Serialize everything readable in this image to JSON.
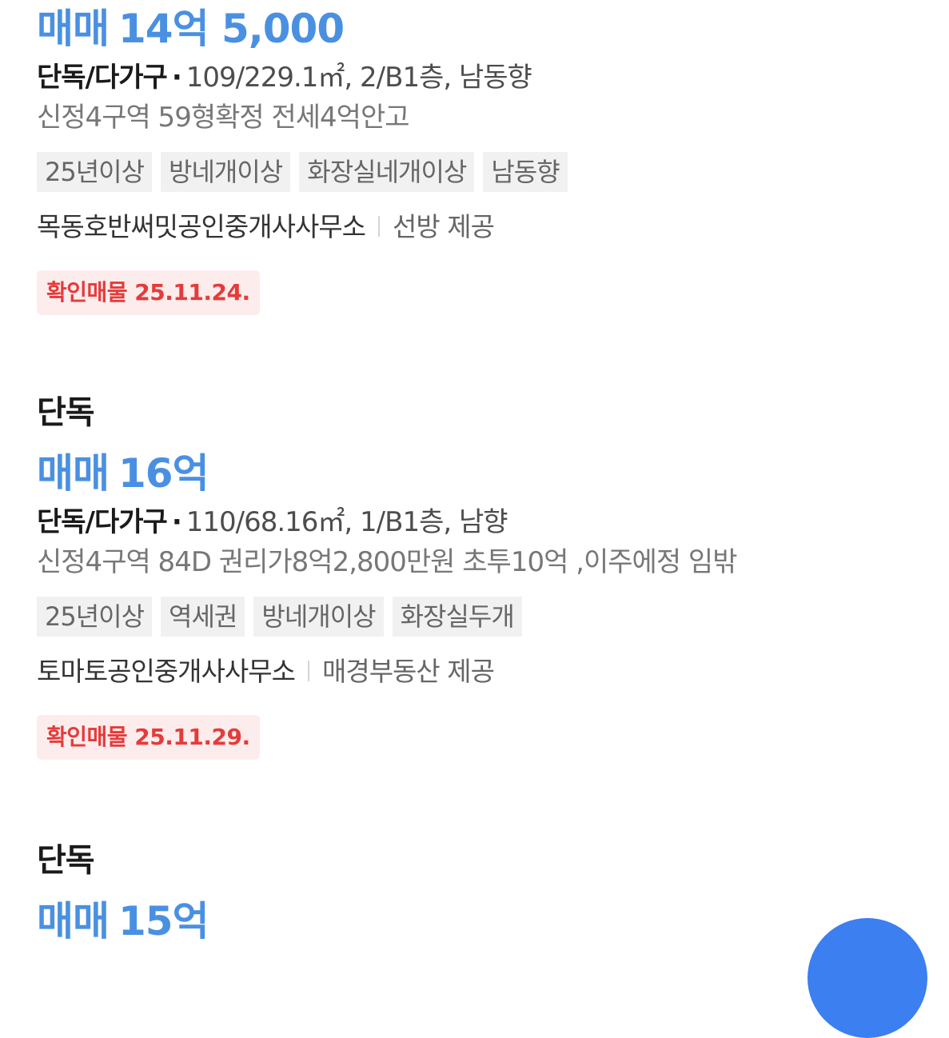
{
  "listings": [
    {
      "type_label": "",
      "price_label": "매매",
      "price_value": "14억 5,000",
      "kind": "단독/다가구",
      "dot": "·",
      "spec": "109/229.1㎡, 2/B1층, 남동향",
      "description": "신정4구역 59형확정 전세4억안고",
      "tags": [
        "25년이상",
        "방네개이상",
        "화장실네개이상",
        "남동향"
      ],
      "agency": "목동호반써밋공인중개사사무소",
      "provider": "선방 제공",
      "verified": "확인매물 25.11.24."
    },
    {
      "type_label": "단독",
      "price_label": "매매",
      "price_value": "16억",
      "kind": "단독/다가구",
      "dot": "·",
      "spec": "110/68.16㎡, 1/B1층, 남향",
      "description": "신정4구역 84D 권리가8억2,800만원 초투10억 ,이주에정 임밖",
      "tags": [
        "25년이상",
        "역세권",
        "방네개이상",
        "화장실두개"
      ],
      "agency": "토마토공인중개사사무소",
      "provider": "매경부동산 제공",
      "verified": "확인매물 25.11.29."
    },
    {
      "type_label": "단독",
      "price_label": "매매",
      "price_value": "15억"
    }
  ],
  "colors": {
    "price": "#4a90e2",
    "verified_text": "#e53b3b",
    "verified_bg": "#fdecec",
    "tag_bg": "#f1f1f1",
    "fab": "#3b7ff0"
  },
  "fab": {
    "icon": "floating-action-button"
  }
}
